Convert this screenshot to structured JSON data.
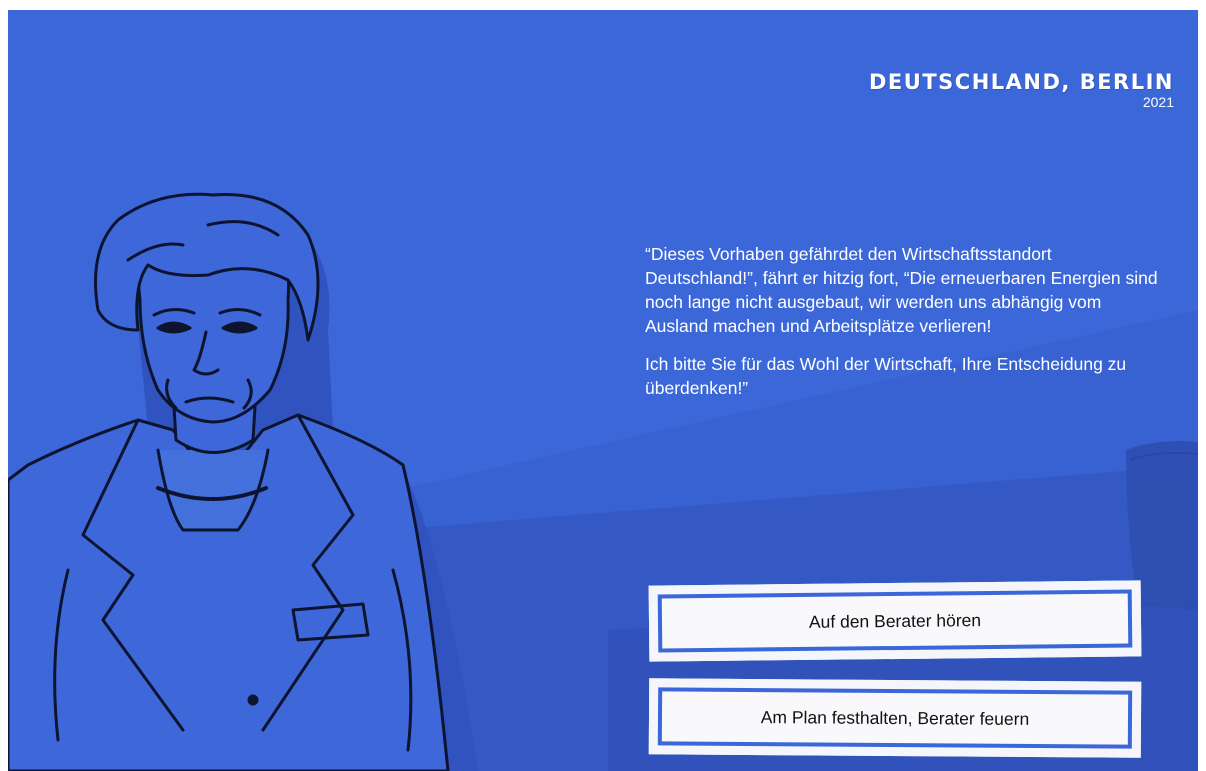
{
  "location": {
    "title": "DEUTSCHLAND, BERLIN",
    "year": "2021"
  },
  "dialogue": {
    "paragraphs": [
      "“Dieses Vorhaben gefährdet den Wirtschaftsstandort Deutschland!”, fährt er hitzig fort, “Die erneuerbaren Energien sind noch lange nicht ausgebaut, wir werden uns abhängig vom Ausland machen und Arbeitsplätze verlieren!",
      "Ich bitte Sie für das Wohl der Wirtschaft, Ihre Entscheidung zu überdenken!”"
    ]
  },
  "choices": [
    {
      "label": "Auf den Berater hören"
    },
    {
      "label": "Am Plan festhalten, Berater feuern"
    }
  ],
  "colors": {
    "background": "#3c67d8",
    "panel_shadow": "#3458c2",
    "button_bg": "#f5f6fb",
    "button_border": "#3c67d8",
    "text_light": "#ffffff",
    "text_dark": "#111111"
  },
  "character": {
    "icon": "chancellor-portrait-illustration"
  }
}
